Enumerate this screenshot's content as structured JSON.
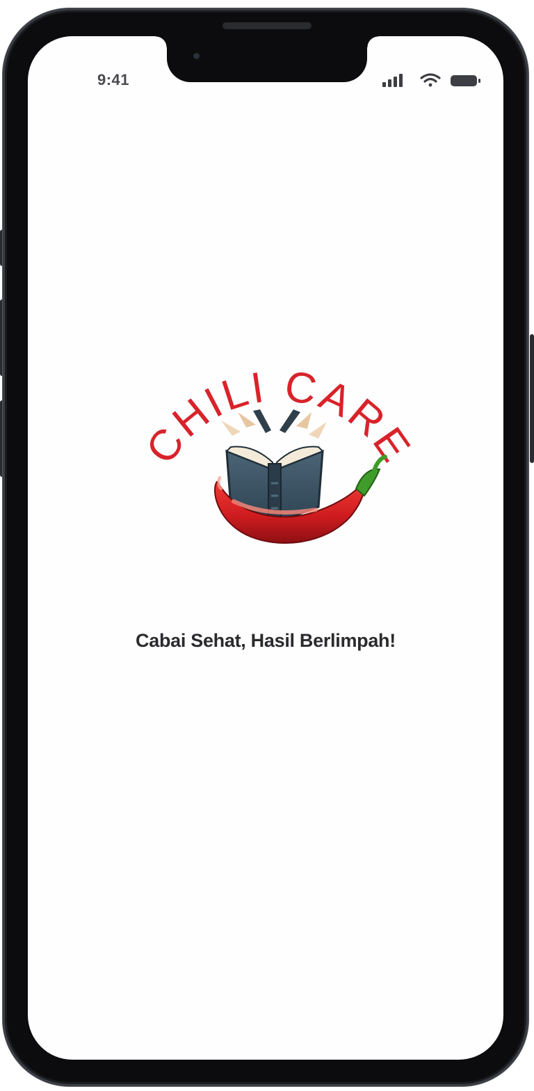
{
  "status_bar": {
    "time": "9:41",
    "icons": [
      "cellular-signal-icon",
      "wifi-icon",
      "battery-icon"
    ]
  },
  "logo": {
    "wordmark": "CHILI CARE",
    "wordmark_color": "#d8232a",
    "icons": [
      "open-book-icon",
      "chili-pepper-icon"
    ]
  },
  "tagline": "Cabai Sehat, Hasil Berlimpah!",
  "colors": {
    "screen_bg": "#fefefe",
    "frame": "#1a1b1f",
    "text": "#2b2b2e",
    "chili_red": "#d8232a",
    "book_blue": "#3e5667"
  }
}
